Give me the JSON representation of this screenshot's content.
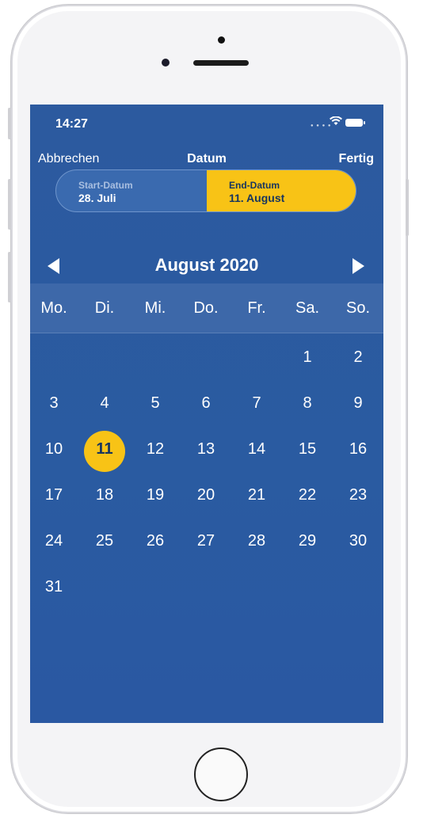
{
  "status": {
    "time": "14:27"
  },
  "nav": {
    "cancel": "Abbrechen",
    "title": "Datum",
    "done": "Fertig"
  },
  "range": {
    "start_label": "Start-Datum",
    "start_value": "28. Juli",
    "end_label": "End-Datum",
    "end_value": "11. August",
    "active": "end"
  },
  "calendar": {
    "month_title": "August 2020",
    "weekdays": [
      "Mo.",
      "Di.",
      "Mi.",
      "Do.",
      "Fr.",
      "Sa.",
      "So."
    ],
    "selected_day": "11",
    "weeks": [
      [
        "",
        "",
        "",
        "",
        "",
        "1",
        "2"
      ],
      [
        "3",
        "4",
        "5",
        "6",
        "7",
        "8",
        "9"
      ],
      [
        "10",
        "11",
        "12",
        "13",
        "14",
        "15",
        "16"
      ],
      [
        "17",
        "18",
        "19",
        "20",
        "21",
        "22",
        "23"
      ],
      [
        "24",
        "25",
        "26",
        "27",
        "28",
        "29",
        "30"
      ],
      [
        "31",
        "",
        "",
        "",
        "",
        "",
        ""
      ]
    ]
  },
  "colors": {
    "background": "#2a5ba1",
    "accent": "#f8c316",
    "dark_text": "#17355f"
  },
  "icons": {
    "prev": "caret-left-icon",
    "next": "caret-right-icon",
    "wifi": "wifi-icon",
    "battery": "battery-icon",
    "signal": "signal-icon"
  }
}
